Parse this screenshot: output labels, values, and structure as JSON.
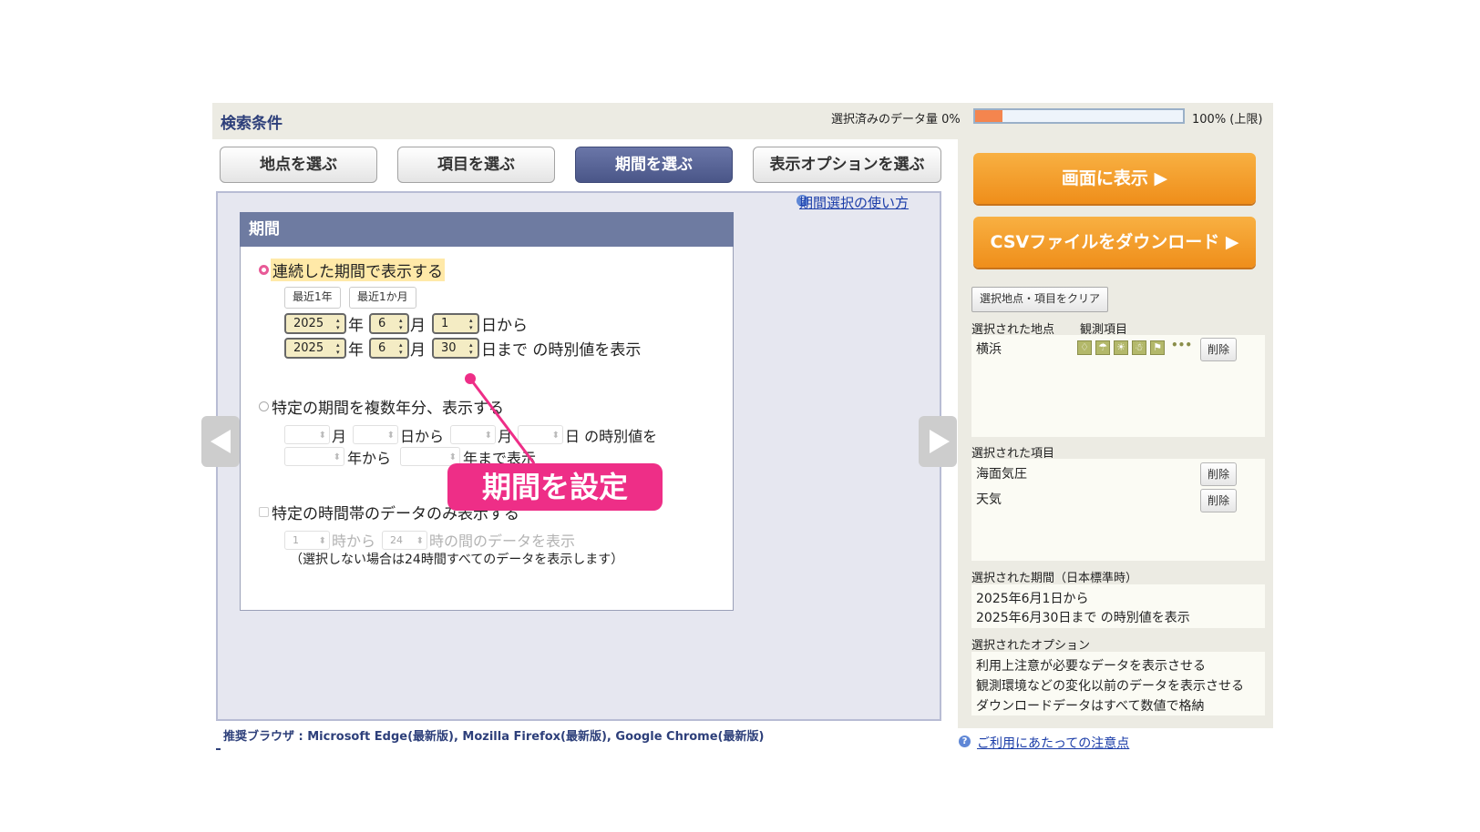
{
  "header": {
    "title": "検索条件",
    "capacity_label": "選択済みのデータ量 0%",
    "capacity_max": "100% (上限)",
    "capacity_fraction": 0.13
  },
  "tabs": [
    {
      "label": "地点を選ぶ",
      "active": false
    },
    {
      "label": "項目を選ぶ",
      "active": false
    },
    {
      "label": "期間を選ぶ",
      "active": true
    },
    {
      "label": "表示オプションを選ぶ",
      "active": false
    }
  ],
  "help_link": "期間選択の使い方",
  "period": {
    "heading": "期間",
    "continuous": {
      "label": "連続した期間で表示する",
      "quick": [
        "最近1年",
        "最近1か月"
      ],
      "from": {
        "year": "2025",
        "month": "6",
        "day": "1"
      },
      "to": {
        "year": "2025",
        "month": "6",
        "day": "30"
      },
      "year_suffix": "年",
      "month_suffix": "月",
      "from_suffix": "日から",
      "to_suffix": "日まで の時別値を表示"
    },
    "multi_year": {
      "label": "特定の期間を複数年分、表示する",
      "month_suffix": "月",
      "day_from_suffix": "日から",
      "day_suffix": "日 の時別値を",
      "year_from_suffix": "年から",
      "year_to_suffix": "年まで表示"
    },
    "hours": {
      "label": "特定の時間帯のデータのみ表示する",
      "from_value": "1",
      "from_suffix": "時から",
      "to_value": "24",
      "to_suffix": "時の間のデータを表示",
      "note": "（選択しない場合は24時間すべてのデータを表示します）"
    }
  },
  "annotation": "期間を設定",
  "right": {
    "show_button": "画面に表示 ▶",
    "csv_button": "CSVファイルをダウンロード ▶",
    "clear_button": "選択地点・項目をクリア",
    "selected_stations_label": "選択された地点",
    "observation_items_label": "観測項目",
    "station": "横浜",
    "station_icons": [
      "weather-icon",
      "umbrella-icon",
      "sun-icon",
      "snowman-icon",
      "wind-icon"
    ],
    "more": "•••",
    "delete_label": "削除",
    "selected_items_label": "選択された項目",
    "items": [
      "海面気圧",
      "天気"
    ],
    "selected_period_label": "選択された期間（日本標準時）",
    "period_lines": [
      "2025年6月1日から",
      "2025年6月30日まで の時別値を表示"
    ],
    "selected_options_label": "選択されたオプション",
    "options": [
      "利用上注意が必要なデータを表示させる",
      "観測環境などの変化以前のデータを表示させる",
      "ダウンロードデータはすべて数値で格納"
    ]
  },
  "notice_link": "ご利用にあたっての注意点",
  "browser_note": "推奨ブラウザ : Microsoft Edge(最新版), Mozilla Firefox(最新版), Google Chrome(最新版)"
}
